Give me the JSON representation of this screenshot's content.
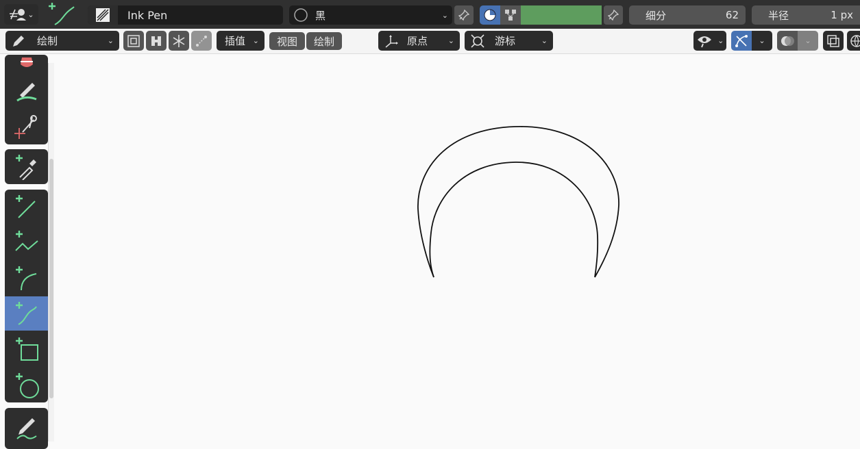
{
  "header": {
    "brush_name": "Ink Pen",
    "material_name": "黑",
    "color_hex": "#5e9d5e",
    "subdivisions_label": "细分",
    "subdivisions_value": "62",
    "radius_label": "半径",
    "radius_value": "1 px"
  },
  "toolbar": {
    "mode_label": "绘制",
    "interpolate_label": "插值",
    "view_label": "视图",
    "draw_label": "绘制",
    "origin_label": "原点",
    "cursor_label": "游标"
  },
  "canvas": {
    "background": "#fafafa",
    "stroke_color": "#111111"
  },
  "tools": [
    "erase-tool",
    "tint-tool",
    "cutter-tool",
    "eyedropper-tool",
    "line-tool",
    "polyline-tool",
    "arc-tool",
    "curve-tool",
    "box-tool",
    "circle-tool",
    "annotate-tool"
  ],
  "active_tool": "curve-tool",
  "accent_color": "#5a7fc1",
  "tool_icon_color": "#6fdc9a"
}
